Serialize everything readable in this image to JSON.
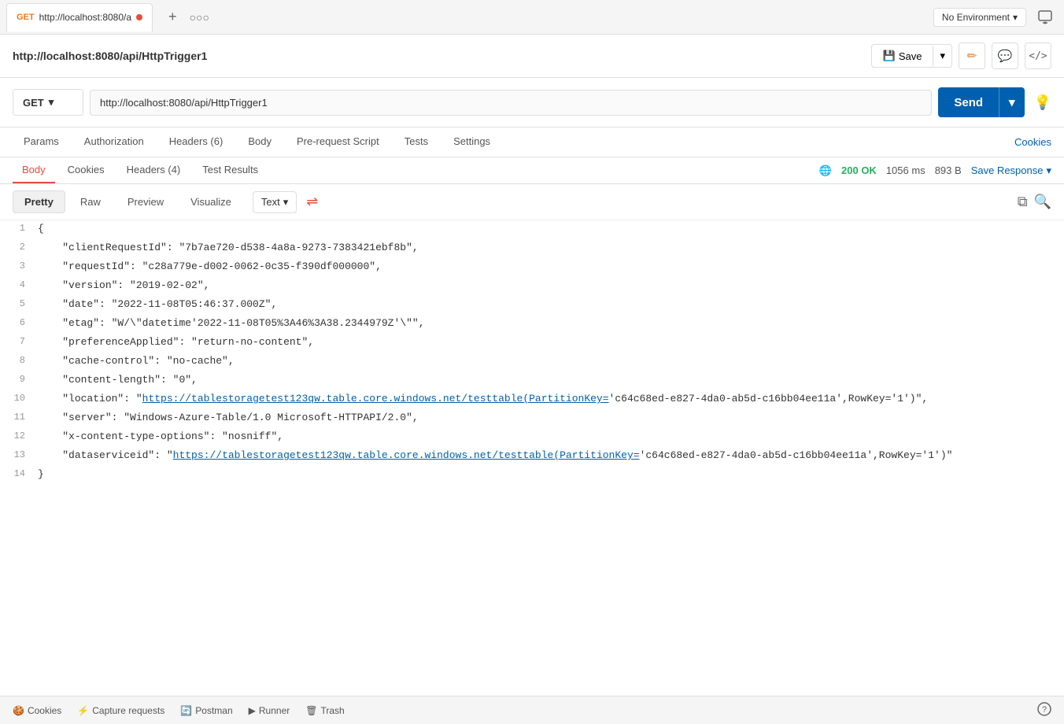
{
  "tabBar": {
    "tab": {
      "method": "GET",
      "url": "http://localhost:8080/a"
    },
    "plusLabel": "+",
    "moreLabel": "○○○",
    "environment": {
      "label": "No Environment",
      "chevron": "▾"
    }
  },
  "urlBar": {
    "title": "http://localhost:8080/api/HttpTrigger1",
    "saveLabel": "Save",
    "saveIcon": "💾"
  },
  "requestBar": {
    "method": "GET",
    "url": "http://localhost:8080/api/HttpTrigger1",
    "sendLabel": "Send"
  },
  "requestTabs": {
    "tabs": [
      "Params",
      "Authorization",
      "Headers (6)",
      "Body",
      "Pre-request Script",
      "Tests",
      "Settings"
    ],
    "activeTab": "Body",
    "rightLabel": "Cookies"
  },
  "responseTabs": {
    "tabs": [
      "Body",
      "Cookies",
      "Headers (4)",
      "Test Results"
    ],
    "activeTab": "Body",
    "status": "200 OK",
    "time": "1056 ms",
    "size": "893 B",
    "saveResponse": "Save Response"
  },
  "bodyToolbar": {
    "views": [
      "Pretty",
      "Raw",
      "Preview",
      "Visualize"
    ],
    "activeView": "Pretty",
    "format": "Text",
    "formatChevron": "▾"
  },
  "codeLines": [
    {
      "num": 1,
      "content": "{"
    },
    {
      "num": 2,
      "content": "    \"clientRequestId\": \"7b7ae720-d538-4a8a-9273-7383421ebf8b\","
    },
    {
      "num": 3,
      "content": "    \"requestId\": \"c28a779e-d002-0062-0c35-f390df000000\","
    },
    {
      "num": 4,
      "content": "    \"version\": \"2019-02-02\","
    },
    {
      "num": 5,
      "content": "    \"date\": \"2022-11-08T05:46:37.000Z\","
    },
    {
      "num": 6,
      "content": "    \"etag\": \"W/\\\"datetime'2022-11-08T05%3A46%3A38.2344979Z'\\\"\","
    },
    {
      "num": 7,
      "content": "    \"preferenceApplied\": \"return-no-content\","
    },
    {
      "num": 8,
      "content": "    \"cache-control\": \"no-cache\","
    },
    {
      "num": 9,
      "content": "    \"content-length\": \"0\","
    },
    {
      "num": 10,
      "content": "    \"location\": \"https://tablestoragetest123qw.table.core.windows.net/testtable(PartitionKey='c64c68ed-e827-4da0-ab5d-c16bb04ee11a',RowKey='1')\","
    },
    {
      "num": 11,
      "content": "    \"server\": \"Windows-Azure-Table/1.0 Microsoft-HTTPAPI/2.0\","
    },
    {
      "num": 12,
      "content": "    \"x-content-type-options\": \"nosniff\","
    },
    {
      "num": 13,
      "content": "    \"dataserviceid\": \"https://tablestoragetest123qw.table.core.windows.net/testtable(PartitionKey='c64c68ed-e827-4da0-ab5d-c16bb04ee11a',RowKey='1')\""
    },
    {
      "num": 14,
      "content": "}"
    }
  ],
  "bottomBar": {
    "items": [
      "🍪 Cookies",
      "⚡ Capture requests",
      "🔄 Postman",
      "▶ Runner",
      "🗑 Trash"
    ]
  }
}
